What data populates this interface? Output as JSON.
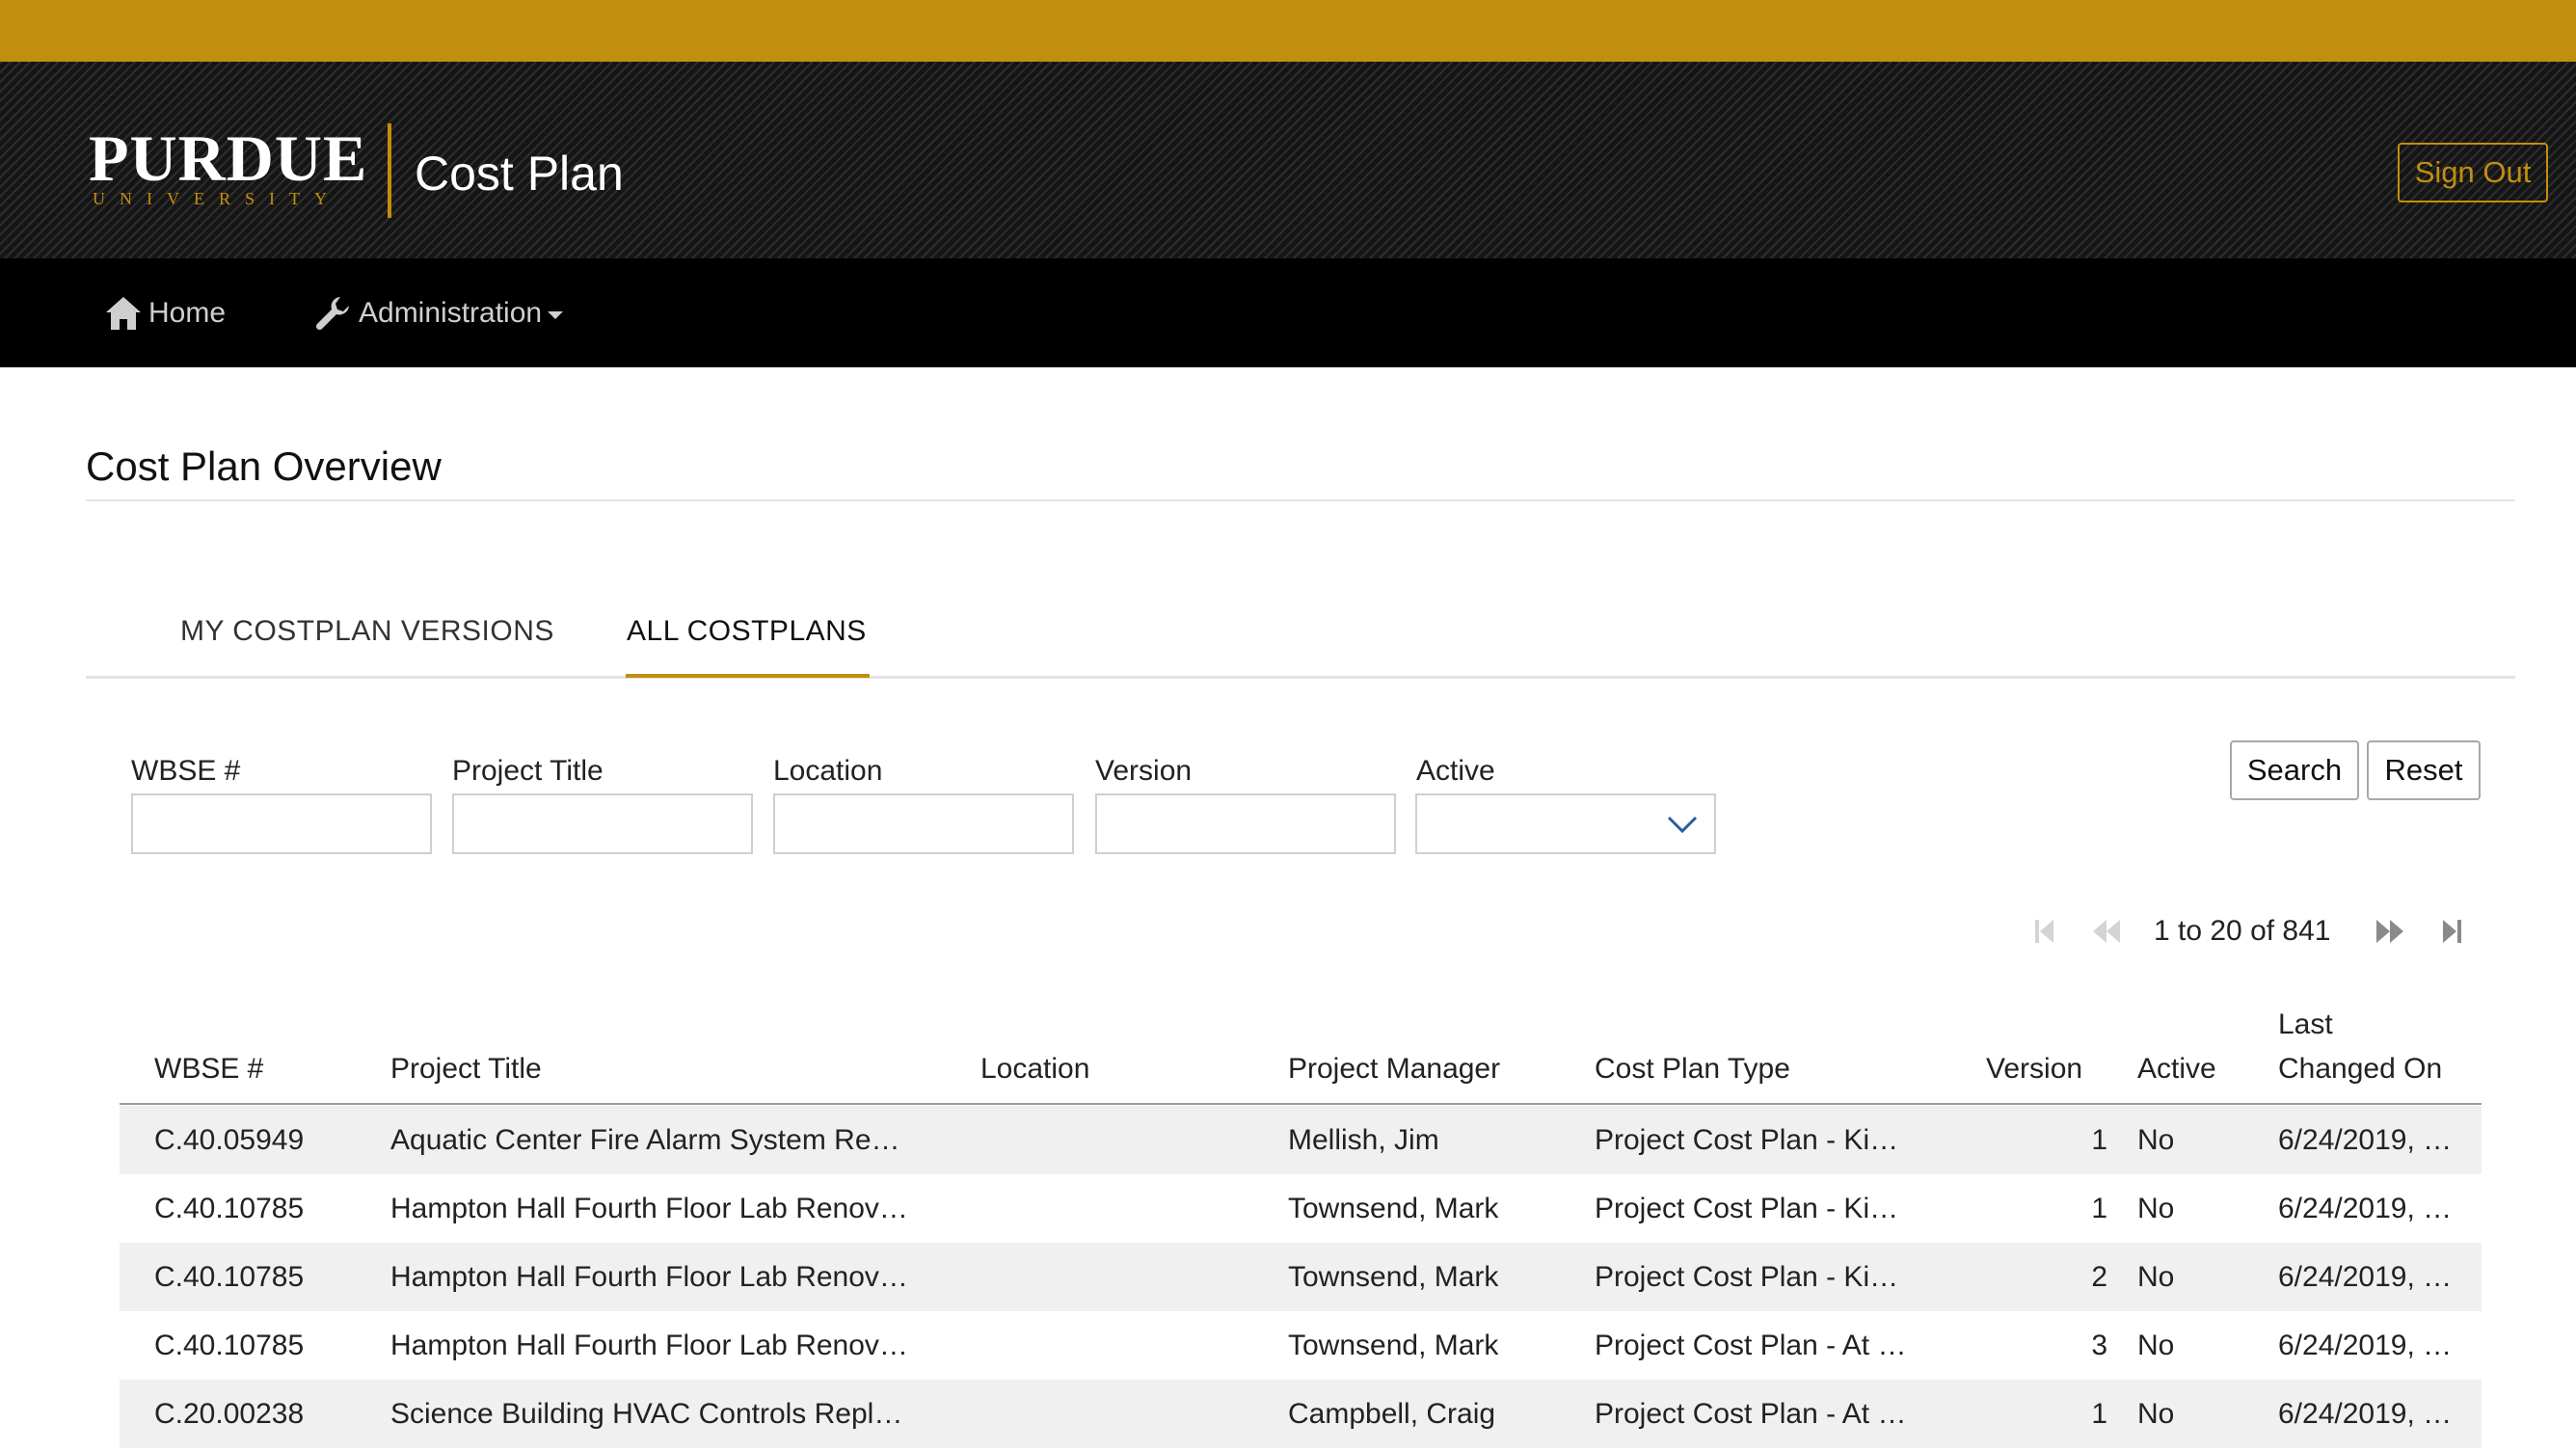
{
  "header": {
    "logo_word": "PURDUE",
    "logo_sub": "UNIVERSITY",
    "app_title": "Cost Plan",
    "signout_label": "Sign Out"
  },
  "nav": {
    "home_label": "Home",
    "admin_label": "Administration"
  },
  "page": {
    "title": "Cost Plan Overview"
  },
  "tabs": [
    {
      "label": "MY COSTPLAN VERSIONS",
      "active": false
    },
    {
      "label": "ALL COSTPLANS",
      "active": true
    }
  ],
  "filters": {
    "wbse_label": "WBSE #",
    "title_label": "Project Title",
    "location_label": "Location",
    "version_label": "Version",
    "active_label": "Active",
    "active_value": "",
    "search_label": "Search",
    "reset_label": "Reset"
  },
  "pager": {
    "text": "1 to 20 of 841"
  },
  "table": {
    "headers": {
      "wbse": "WBSE #",
      "title": "Project Title",
      "location": "Location",
      "manager": "Project Manager",
      "type": "Cost Plan Type",
      "version": "Version",
      "active": "Active",
      "changed_line1": "Last",
      "changed_line2": "Changed On"
    },
    "rows": [
      {
        "wbse": "C.40.05949",
        "title": "Aquatic Center Fire Alarm System Re…",
        "location": "",
        "manager": "Mellish, Jim",
        "type": "Project Cost Plan - Ki…",
        "version": "1",
        "active": "No",
        "changed": "6/24/2019, …"
      },
      {
        "wbse": "C.40.10785",
        "title": "Hampton Hall Fourth Floor Lab Renov…",
        "location": "",
        "manager": "Townsend, Mark",
        "type": "Project Cost Plan - Ki…",
        "version": "1",
        "active": "No",
        "changed": "6/24/2019, …"
      },
      {
        "wbse": "C.40.10785",
        "title": "Hampton Hall Fourth Floor Lab Renov…",
        "location": "",
        "manager": "Townsend, Mark",
        "type": "Project Cost Plan - Ki…",
        "version": "2",
        "active": "No",
        "changed": "6/24/2019, …"
      },
      {
        "wbse": "C.40.10785",
        "title": "Hampton Hall Fourth Floor Lab Renov…",
        "location": "",
        "manager": "Townsend, Mark",
        "type": "Project Cost Plan - At …",
        "version": "3",
        "active": "No",
        "changed": "6/24/2019, …"
      },
      {
        "wbse": "C.20.00238",
        "title": "Science Building HVAC Controls Repl…",
        "location": "",
        "manager": "Campbell, Craig",
        "type": "Project Cost Plan - At …",
        "version": "1",
        "active": "No",
        "changed": "6/24/2019, …"
      }
    ]
  },
  "colors": {
    "gold": "#c28e0e",
    "black": "#000000"
  }
}
